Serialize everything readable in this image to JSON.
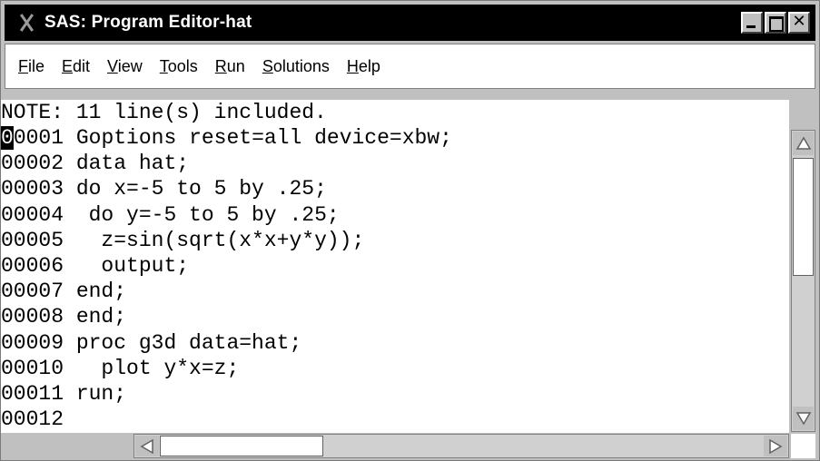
{
  "window": {
    "title": "SAS: Program Editor-hat"
  },
  "menu": {
    "items": [
      {
        "label": "File",
        "accel": "F",
        "rest": "ile"
      },
      {
        "label": "Edit",
        "accel": "E",
        "rest": "dit"
      },
      {
        "label": "View",
        "accel": "V",
        "rest": "iew"
      },
      {
        "label": "Tools",
        "accel": "T",
        "rest": "ools"
      },
      {
        "label": "Run",
        "accel": "R",
        "rest": "un"
      },
      {
        "label": "Solutions",
        "accel": "S",
        "rest": "olutions"
      },
      {
        "label": "Help",
        "accel": "H",
        "rest": "elp"
      }
    ]
  },
  "editor": {
    "note": "NOTE: 11 line(s) included.",
    "cursor_char": "0",
    "lines": [
      {
        "num": "00001",
        "code": "Goptions reset=all device=xbw;"
      },
      {
        "num": "00002",
        "code": "data hat;"
      },
      {
        "num": "00003",
        "code": "do x=-5 to 5 by .25;"
      },
      {
        "num": "00004",
        "code": " do y=-5 to 5 by .25;"
      },
      {
        "num": "00005",
        "code": "  z=sin(sqrt(x*x+y*y));"
      },
      {
        "num": "00006",
        "code": "  output;"
      },
      {
        "num": "00007",
        "code": "end;"
      },
      {
        "num": "00008",
        "code": "end;"
      },
      {
        "num": "00009",
        "code": "proc g3d data=hat;"
      },
      {
        "num": "00010",
        "code": "  plot y*x=z;"
      },
      {
        "num": "00011",
        "code": "run;"
      },
      {
        "num": "00012",
        "code": ""
      }
    ]
  },
  "icons": {
    "window_icon": "sas-x-icon",
    "minimize": "minimize-icon",
    "maximize": "maximize-icon",
    "close": "close-icon",
    "close_glyph": "✕"
  },
  "colors": {
    "titlebar_bg": "#000000",
    "window_bg": "#c0c0c0",
    "editor_bg": "#ffffff"
  }
}
